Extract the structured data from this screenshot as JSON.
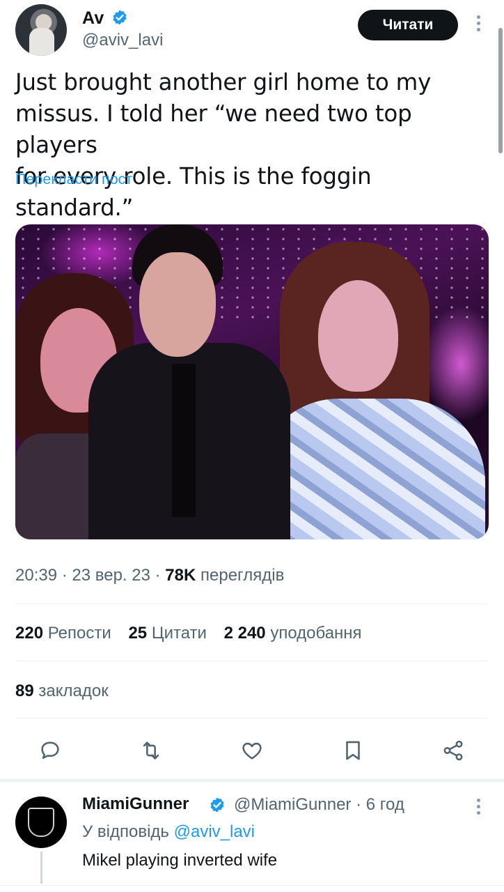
{
  "author": {
    "name": "Av",
    "handle": "@aviv_lavi",
    "follow_label": "Читати"
  },
  "tweet": {
    "text": "Just brought another girl home to my\nmissus. I told her “we need two top players\nfor every role. This is the foggin standard.”",
    "translate_label": "Перекласти пост",
    "time": "20:39",
    "date": "23 вер. 23",
    "views_count": "78K",
    "views_label": "переглядів"
  },
  "stats": {
    "reposts_count": "220",
    "reposts_label": "Репости",
    "quotes_count": "25",
    "quotes_label": "Цитати",
    "likes_count": "2 240",
    "likes_label": "уподобання",
    "bookmarks_count": "89",
    "bookmarks_label": "закладок"
  },
  "actions": {
    "icons": [
      "reply-icon",
      "repost-icon",
      "like-icon",
      "bookmark-icon",
      "share-icon"
    ]
  },
  "reply": {
    "name": "MiamiGunner",
    "handle": "@MiamiGunner",
    "time": "6 год",
    "replying_prefix": "У відповідь",
    "replying_to": "@aviv_lavi",
    "text": "Mikel playing inverted wife"
  },
  "colors": {
    "accent": "#1d9bf0",
    "text": "#0f1419",
    "secondary": "#536471",
    "button_bg": "#0f1419"
  }
}
